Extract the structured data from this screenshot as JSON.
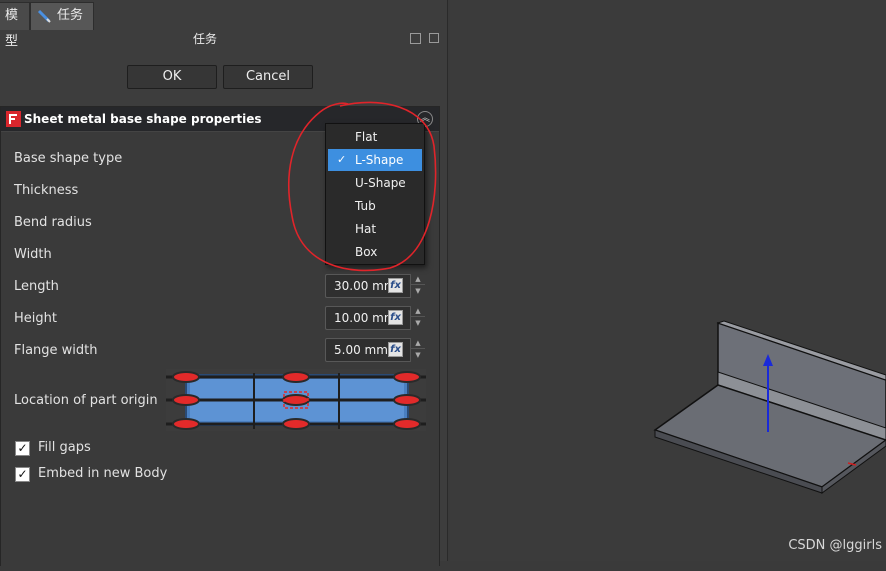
{
  "tabs": {
    "model": "模型",
    "task": "任务"
  },
  "task_panel": {
    "title": "任务",
    "ok_label": "OK",
    "cancel_label": "Cancel"
  },
  "properties": {
    "title": "Sheet metal base shape properties",
    "rows": {
      "base_shape_type": "Base shape type",
      "thickness": "Thickness",
      "bend_radius": "Bend radius",
      "width": "Width",
      "length": "Length",
      "height": "Height",
      "flange_width": "Flange width",
      "origin": "Location of part origin"
    },
    "values": {
      "length": "30.00 mm",
      "height": "10.00 mm",
      "flange_width": "5.00 mm"
    },
    "fx_label": "fx",
    "checkboxes": {
      "fill_gaps": {
        "label": "Fill gaps",
        "checked": true
      },
      "embed_body": {
        "label": "Embed in new Body",
        "checked": true
      }
    }
  },
  "dropdown": {
    "options": [
      "Flat",
      "L-Shape",
      "U-Shape",
      "Tub",
      "Hat",
      "Box"
    ],
    "selected": "L-Shape",
    "check_mark": "✓"
  },
  "colors": {
    "accent": "#3d8fe0",
    "annotation": "#e0242a",
    "background": "#3b3b3b"
  },
  "watermark": "CSDN @lggirls"
}
